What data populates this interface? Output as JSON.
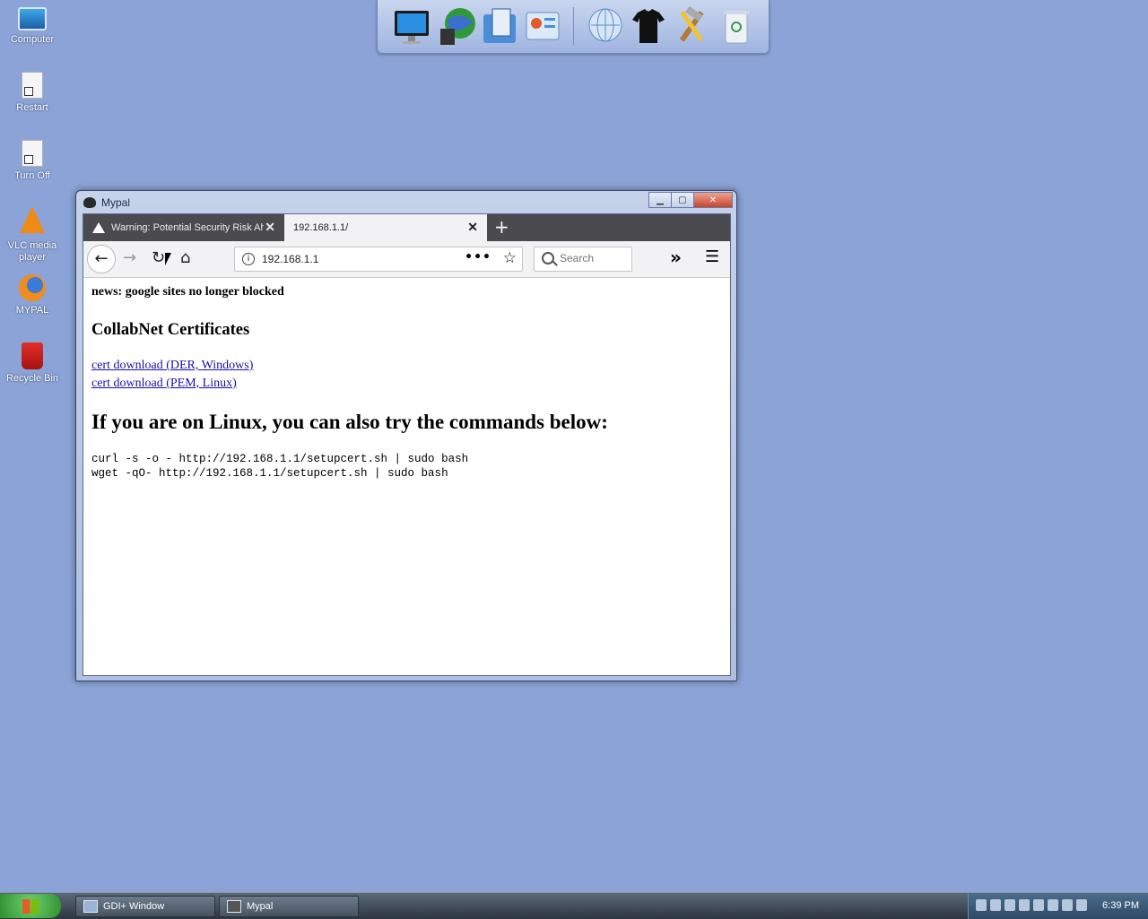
{
  "desktop": {
    "icons": [
      {
        "label": "Computer",
        "icon": "computer-icon"
      },
      {
        "label": "Restart",
        "icon": "shortcut-doc-icon"
      },
      {
        "label": "Turn Off",
        "icon": "shortcut-doc-icon"
      },
      {
        "label": "VLC media player",
        "icon": "vlc-icon"
      },
      {
        "label": "MYPAL",
        "icon": "firefox-icon"
      },
      {
        "label": "Recycle Bin",
        "icon": "recycle-bin-icon"
      }
    ]
  },
  "dock": {
    "items": [
      "monitor-icon",
      "network-globe-icon",
      "documents-icon",
      "control-panel-icon",
      "web-globe-icon",
      "tshirt-icon",
      "tools-icon",
      "trash-icon"
    ]
  },
  "window": {
    "title": "Mypal",
    "tabs": [
      {
        "label": "Warning: Potential Security Risk Ahead",
        "active": false
      },
      {
        "label": "192.168.1.1/",
        "active": true
      }
    ],
    "url": "192.168.1.1",
    "search_placeholder": "Search"
  },
  "page": {
    "news": "news: google sites no longer blocked",
    "heading_cert": "CollabNet Certificates",
    "link_der": "cert download (DER, Windows)",
    "link_pem": "cert download (PEM, Linux)",
    "heading_linux": "If you are on Linux, you can also try the commands below:",
    "cmd_curl": "curl -s -o - http://192.168.1.1/setupcert.sh | sudo bash",
    "cmd_wget": "wget -qO- http://192.168.1.1/setupcert.sh | sudo bash"
  },
  "taskbar": {
    "buttons": [
      {
        "label": "GDI+ Window"
      },
      {
        "label": "Mypal"
      }
    ],
    "clock": "6:39 PM"
  },
  "colors": {
    "desktop_bg": "#8ba3d6",
    "link": "#1a0dab",
    "tabbar": "#4a4a4f"
  }
}
